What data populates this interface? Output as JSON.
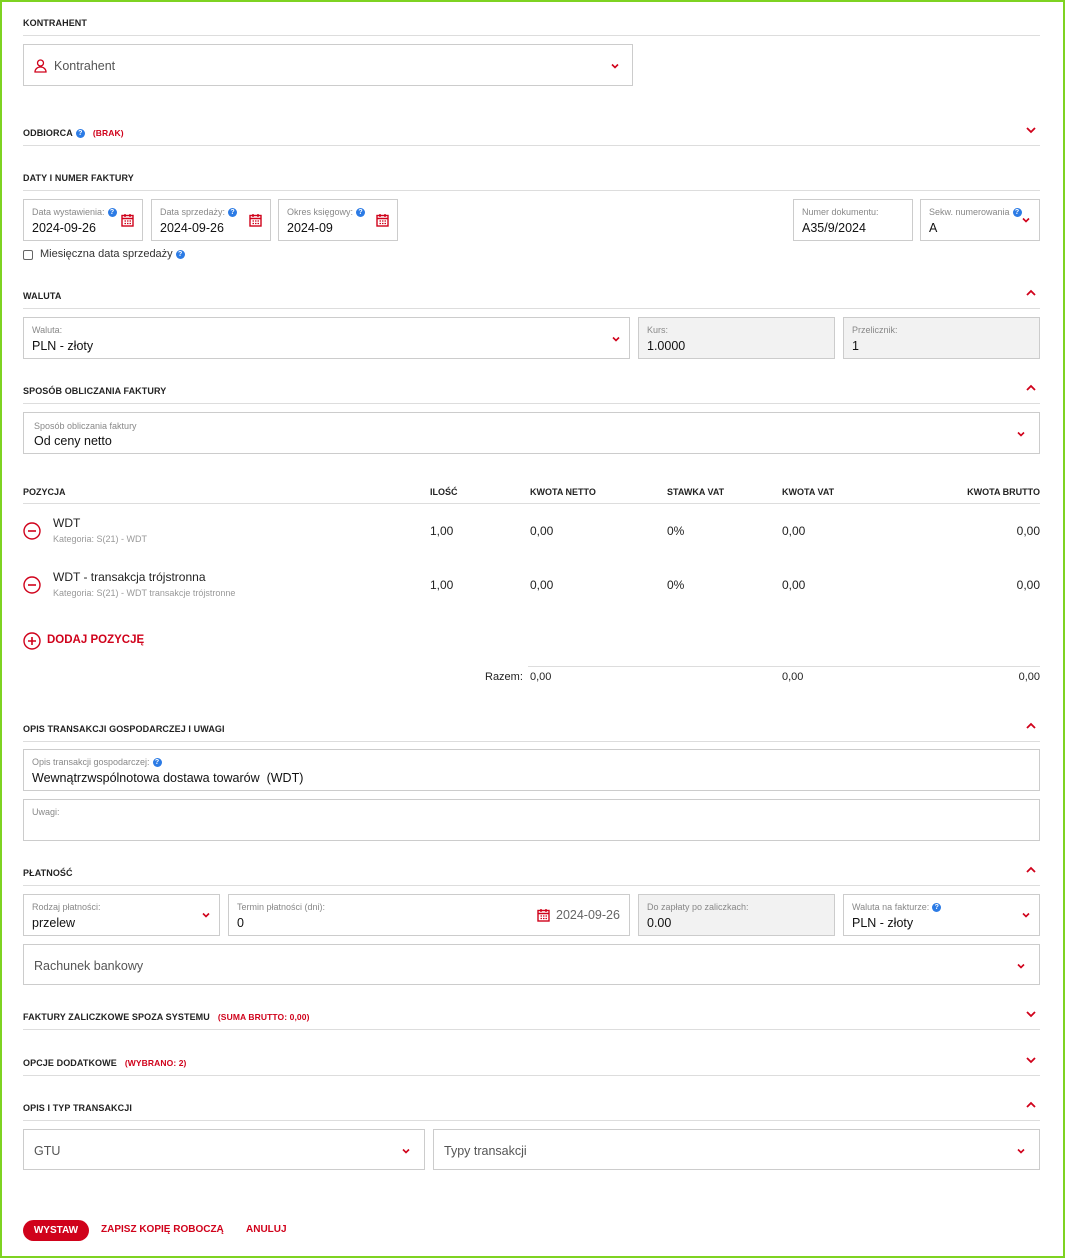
{
  "kontrahent": {
    "section": "KONTRAHENT",
    "placeholder": "Kontrahent"
  },
  "odbiorca": {
    "section": "ODBIORCA",
    "status": "(BRAK)"
  },
  "daty": {
    "section": "DATY I NUMER FAKTURY",
    "issue_label": "Data wystawienia:",
    "issue_value": "2024-09-26",
    "sale_label": "Data sprzedaży:",
    "sale_value": "2024-09-26",
    "period_label": "Okres księgowy:",
    "period_value": "2024-09",
    "docnum_label": "Numer dokumentu:",
    "docnum_value": "A35/9/2024",
    "seq_label": "Sekw. numerowania",
    "seq_value": "A",
    "monthly_label": "Miesięczna data sprzedaży"
  },
  "waluta": {
    "section": "WALUTA",
    "currency_label": "Waluta:",
    "currency_value": "PLN - złoty",
    "rate_label": "Kurs:",
    "rate_value": "1.0000",
    "multiplier_label": "Przelicznik:",
    "multiplier_value": "1"
  },
  "sposob": {
    "section": "SPOSÓB OBLICZANIA FAKTURY",
    "label": "Sposób obliczania faktury",
    "value": "Od ceny netto"
  },
  "items": {
    "headers": [
      "POZYCJA",
      "ILOŚĆ",
      "KWOTA NETTO",
      "STAWKA VAT",
      "KWOTA VAT",
      "KWOTA BRUTTO"
    ],
    "rows": [
      {
        "name": "WDT",
        "category": "Kategoria: S(21) - WDT",
        "qty": "1,00",
        "net": "0,00",
        "vat_rate": "0%",
        "vat": "0,00",
        "gross": "0,00"
      },
      {
        "name": "WDT - transakcja trójstronna",
        "category": "Kategoria: S(21) - WDT transakcje trójstronne",
        "qty": "1,00",
        "net": "0,00",
        "vat_rate": "0%",
        "vat": "0,00",
        "gross": "0,00"
      }
    ],
    "add_label": "DODAJ POZYCJĘ",
    "total_label": "Razem:",
    "total_net": "0,00",
    "total_vat": "0,00",
    "total_gross": "0,00"
  },
  "opis": {
    "section": "OPIS TRANSAKCJI GOSPODARCZEJ I UWAGI",
    "desc_label": "Opis transakcji gospodarczej:",
    "desc_value": "Wewnątrzwspólnotowa dostawa towarów  (WDT)",
    "notes_label": "Uwagi:"
  },
  "platnosc": {
    "section": "PŁATNOŚĆ",
    "type_label": "Rodzaj płatności:",
    "type_value": "przelew",
    "term_label": "Termin płatności (dni):",
    "term_value": "0",
    "term_date": "2024-09-26",
    "due_label": "Do zapłaty po zaliczkach:",
    "due_value": "0.00",
    "inv_currency_label": "Waluta na fakturze:",
    "inv_currency_value": "PLN - złoty",
    "bank_placeholder": "Rachunek bankowy"
  },
  "zaliczkowe": {
    "section": "FAKTURY ZALICZKOWE SPOZA SYSTEMU",
    "status": "(SUMA BRUTTO: 0,00)"
  },
  "opcje": {
    "section": "OPCJE DODATKOWE",
    "status": "(WYBRANO: 2)"
  },
  "typ": {
    "section": "OPIS I TYP TRANSAKCJI",
    "gtu_placeholder": "GTU",
    "types_placeholder": "Typy transakcji"
  },
  "actions": {
    "issue": "WYSTAW",
    "draft": "ZAPISZ KOPIĘ ROBOCZĄ",
    "cancel": "ANULUJ"
  },
  "colors": {
    "accent": "#d0021b",
    "help": "#2c7be5",
    "frame": "#7ed321"
  }
}
